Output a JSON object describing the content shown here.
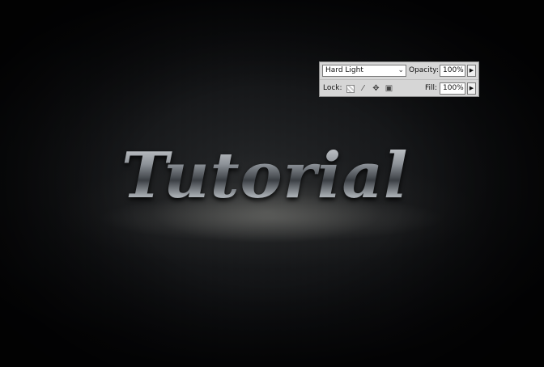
{
  "canvas": {
    "title_text": "Tutorial"
  },
  "layers_panel": {
    "blend_mode": "Hard Light",
    "opacity_label": "Opacity:",
    "opacity_value": "100%",
    "lock_label": "Lock:",
    "fill_label": "Fill:",
    "fill_value": "100%",
    "icons": {
      "blend_dropdown": "chevron-down-icon",
      "opacity_slider": "triangle-right-icon",
      "fill_slider": "triangle-right-icon",
      "lock_transparent": "checkerboard-icon",
      "lock_pixels": "brush-icon",
      "lock_position": "move-icon",
      "lock_all": "padlock-icon"
    }
  }
}
